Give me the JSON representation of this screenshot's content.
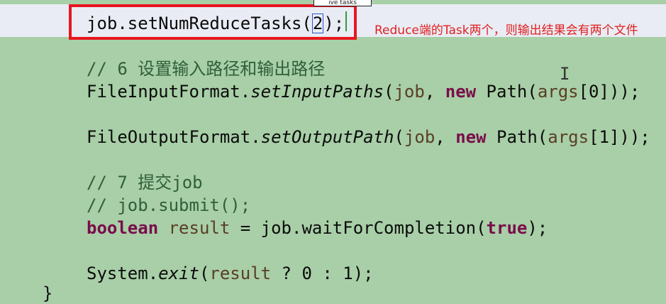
{
  "tooltip": {
    "text": "ive tasks"
  },
  "annotation": {
    "text": "Reduce端的Task两个，则输出结果会有两个文件"
  },
  "code": {
    "line1": {
      "before": "job.setNumReduceTasks(",
      "cursor_char": "2",
      "after": ");"
    },
    "line2": {
      "text": "// 6 设置输入路径和输出路径"
    },
    "line3": {
      "class": "FileInputFormat.",
      "method": "setInputPaths",
      "open": "(",
      "var": "job",
      "sep": ", ",
      "kw": "new",
      "rest1": " Path(",
      "args": "args",
      "rest2": "[0]));"
    },
    "line4": {
      "class": "FileOutputFormat.",
      "method": "setOutputPath",
      "open": "(",
      "var": "job",
      "sep": ", ",
      "kw": "new",
      "rest1": " Path(",
      "args": "args",
      "rest2": "[1]));"
    },
    "line5": {
      "text": "// 7 提交job"
    },
    "line6": {
      "text": "// job.submit();"
    },
    "line7": {
      "kw": "boolean",
      "sp": " ",
      "var": "result",
      "mid": " = job.waitForCompletion(",
      "kw2": "true",
      "end": ");"
    },
    "line8": {
      "class": "System.",
      "method": "exit",
      "open": "(",
      "var": "result",
      "rest": " ? 0 : 1);"
    },
    "line9": {
      "text": "}"
    }
  },
  "colors": {
    "background": "#a8cfa7",
    "highlight_box": "#e8161f",
    "keyword": "#7a0d4b",
    "annotation": "#e02020"
  }
}
